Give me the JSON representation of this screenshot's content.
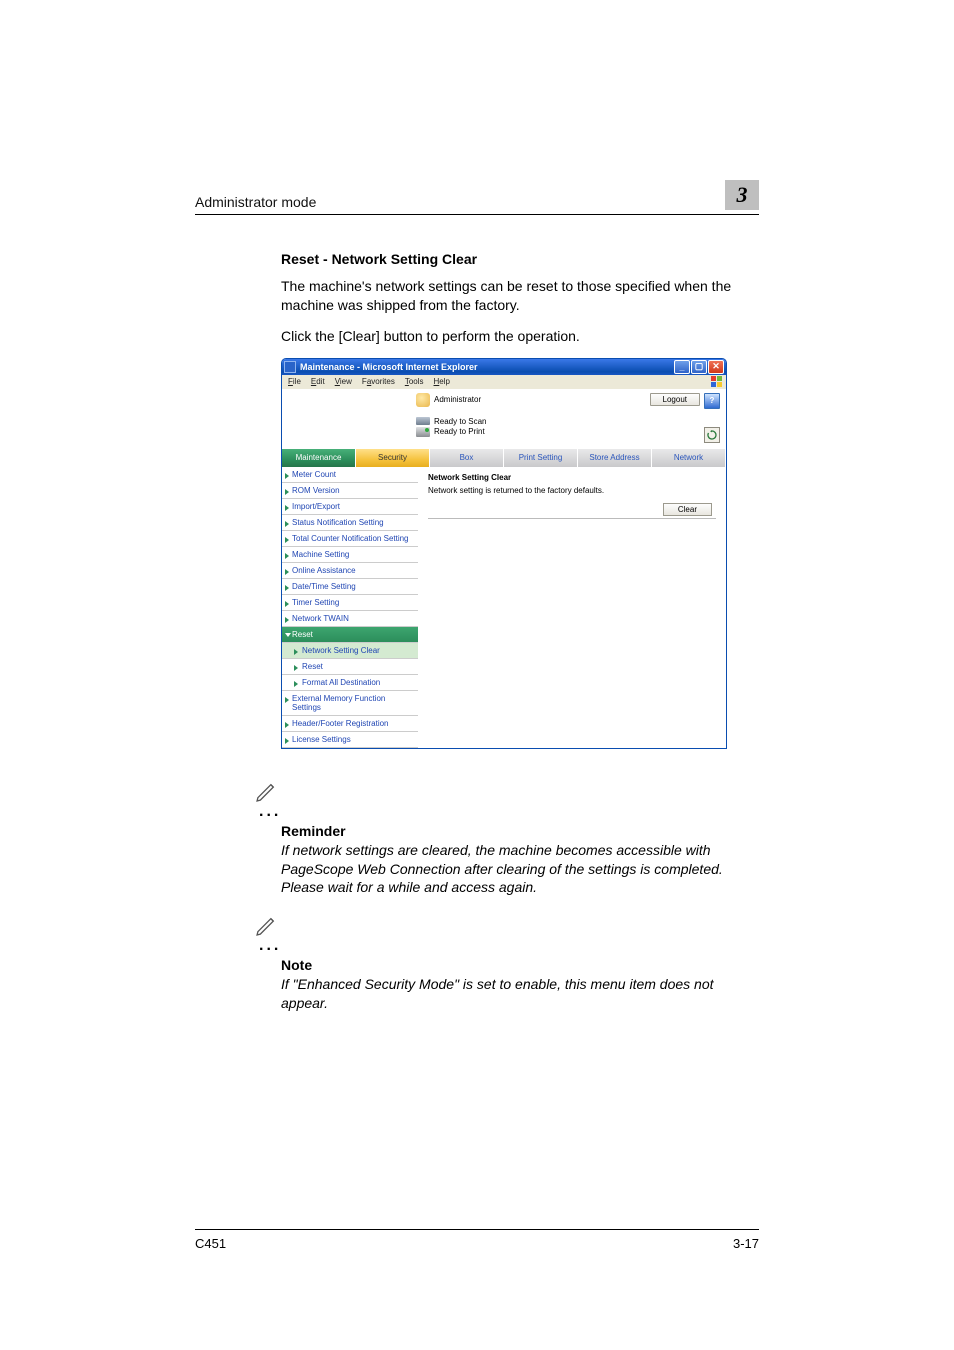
{
  "header": {
    "title": "Administrator mode",
    "chapter": "3"
  },
  "section": {
    "title": "Reset - Network Setting Clear",
    "para1": "The machine's network settings can be reset to those specified when the machine was shipped from the factory.",
    "para2": "Click the [Clear] button to perform the operation."
  },
  "ie": {
    "title": "Maintenance - Microsoft Internet Explorer",
    "menus": {
      "file": "File",
      "edit": "Edit",
      "view": "View",
      "favorites": "Favorites",
      "tools": "Tools",
      "help": "Help"
    },
    "admin_label": "Administrator",
    "status_scan": "Ready to Scan",
    "status_print": "Ready to Print",
    "logout": "Logout",
    "help": "?",
    "tabs": {
      "maintenance": "Maintenance",
      "security": "Security",
      "box": "Box",
      "print": "Print Setting",
      "store": "Store Address",
      "network": "Network"
    },
    "sidebar": {
      "meter": "Meter Count",
      "rom": "ROM Version",
      "import": "Import/Export",
      "status": "Status Notification Setting",
      "total": "Total Counter Notification Setting",
      "machine": "Machine Setting",
      "online": "Online Assistance",
      "datetime": "Date/Time Setting",
      "timer": "Timer Setting",
      "twain": "Network TWAIN",
      "reset": "Reset",
      "nsc": "Network Setting Clear",
      "reset2": "Reset",
      "format": "Format All Destination",
      "ext": "External Memory Function Settings",
      "hf": "Header/Footer Registration",
      "lic": "License Settings"
    },
    "main": {
      "title": "Network Setting Clear",
      "desc": "Network setting is returned to the factory defaults.",
      "clear": "Clear"
    }
  },
  "reminder": {
    "head": "Reminder",
    "body": "If network settings are cleared, the machine becomes accessible with PageScope Web Connection after clearing of the settings is completed. Please wait for a while and access again."
  },
  "note": {
    "head": "Note",
    "body": "If \"Enhanced Security Mode\" is set to enable, this menu item does not appear."
  },
  "footer": {
    "model": "C451",
    "page": "3-17"
  }
}
